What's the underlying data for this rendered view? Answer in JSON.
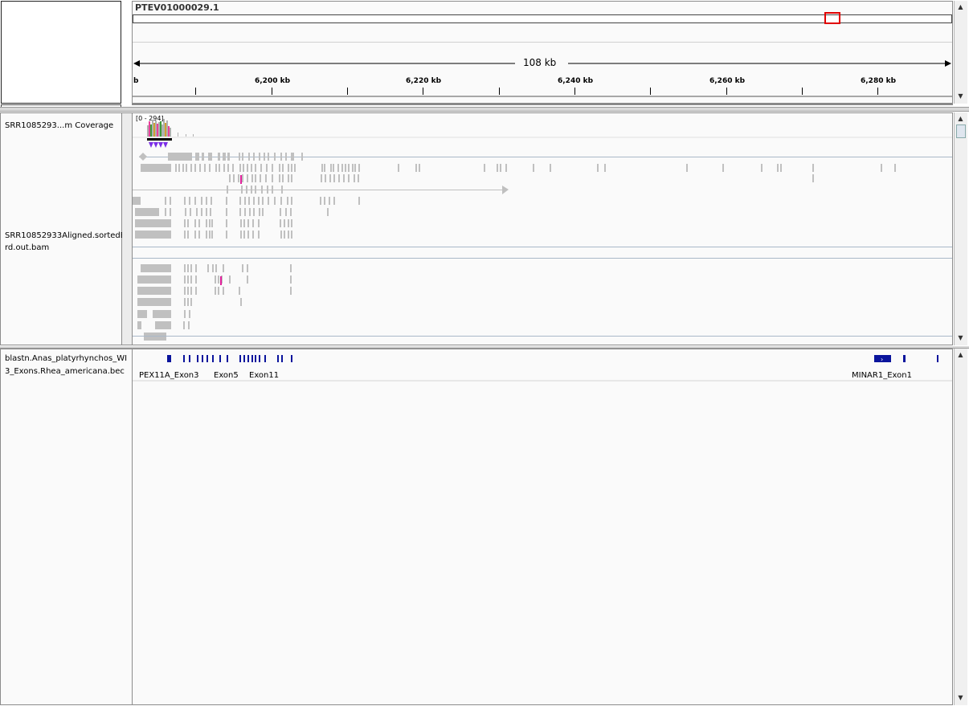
{
  "ideogram": {
    "chromosome": "PTEV01000029.1",
    "span_label": "108 kb",
    "ruler_ticks": [
      {
        "label": "b"
      },
      {
        "label": "6,200 kb"
      },
      {
        "label": "6,220 kb"
      },
      {
        "label": "6,240 kb"
      },
      {
        "label": "6,260 kb"
      },
      {
        "label": "6,280 kb"
      }
    ]
  },
  "tracks": {
    "coverage": {
      "name": "SRR1085293...m Coverage",
      "range": "[0 - 294]"
    },
    "alignment": {
      "name_line1": "SRR10852933Aligned.sortedB",
      "name_line2": "rd.out.bam"
    },
    "blast": {
      "name_line1": "blastn.Anas_platyrhynchos_WI",
      "name_line2": "3_Exons.Rhea_americana.bec",
      "features": [
        {
          "label": "PEX11A_Exon3"
        },
        {
          "label": "Exon5"
        },
        {
          "label": "Exon11"
        },
        {
          "label": "MINAR1_Exon1"
        }
      ]
    }
  },
  "scrollbar": {
    "up_glyph": "▲",
    "down_glyph": "▼"
  },
  "colors": {
    "read_gray": "#c0c0c0",
    "feature_blue": "#0a149c",
    "region_box_red": "#e00000",
    "coverage_purple": "#7b2ee6",
    "splice_line": "#a9b8c8"
  }
}
